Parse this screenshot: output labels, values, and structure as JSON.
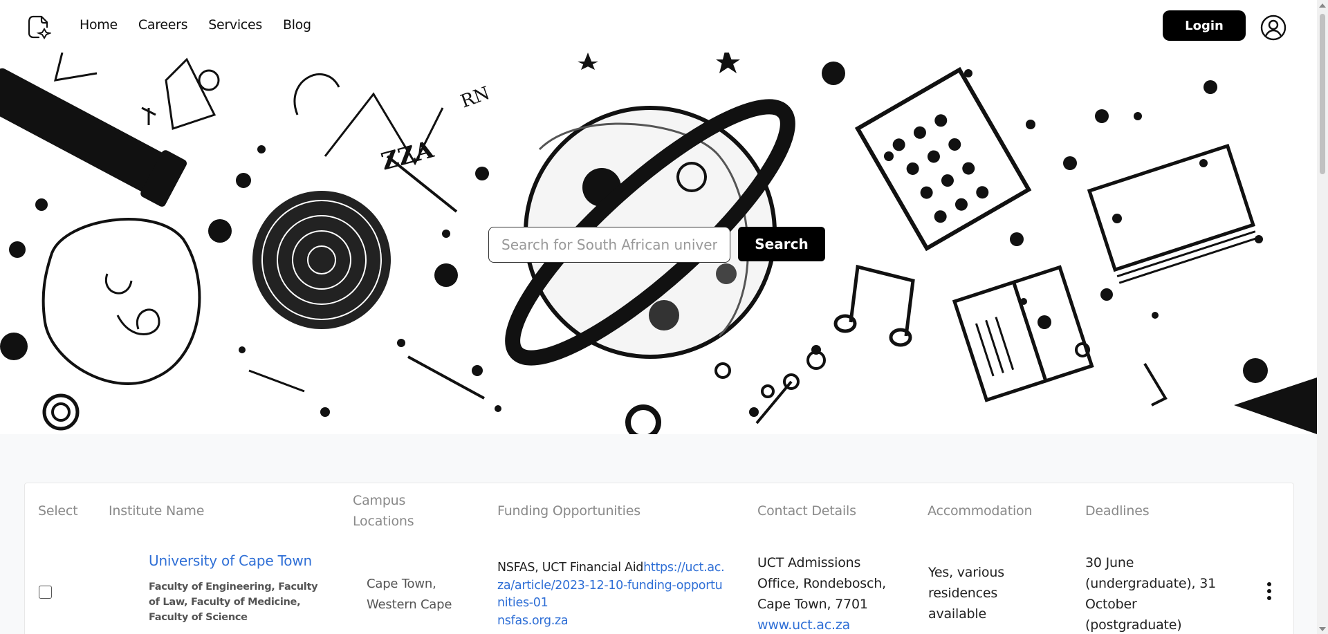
{
  "nav": {
    "items": [
      "Home",
      "Careers",
      "Services",
      "Blog"
    ],
    "login_label": "Login"
  },
  "search": {
    "placeholder": "Search for South African universities",
    "button_label": "Search"
  },
  "table": {
    "headers": {
      "select": "Select",
      "institute": "Institute Name",
      "campus": "Campus Locations",
      "funding": "Funding Opportunities",
      "contact": "Contact Details",
      "accommodation": "Accommodation",
      "deadlines": "Deadlines"
    },
    "rows": [
      {
        "name": "University of Cape Town",
        "faculties": "Faculty of Engineering, Faculty of Law, Faculty of Medicine, Faculty of Science",
        "campus": "Cape Town, Western Cape",
        "funding_text": "NSFAS, UCT Financial Aid",
        "funding_link1": "https://uct.ac.za/article/2023-12-10-funding-opportunities-01",
        "funding_link2": "nsfas.org.za",
        "contact": "UCT Admissions Office, Rondebosch, Cape Town, 7701",
        "contact_link": "www.uct.ac.za",
        "accommodation": "Yes, various residences available",
        "deadlines": "30 June (undergraduate), 31 October (postgraduate)"
      }
    ]
  },
  "colors": {
    "link": "#2f6fd6",
    "header_text": "#8a8a8a",
    "primary_button": "#000000"
  },
  "icons": [
    "logo-icon",
    "account-icon",
    "kebab-menu-icon"
  ]
}
